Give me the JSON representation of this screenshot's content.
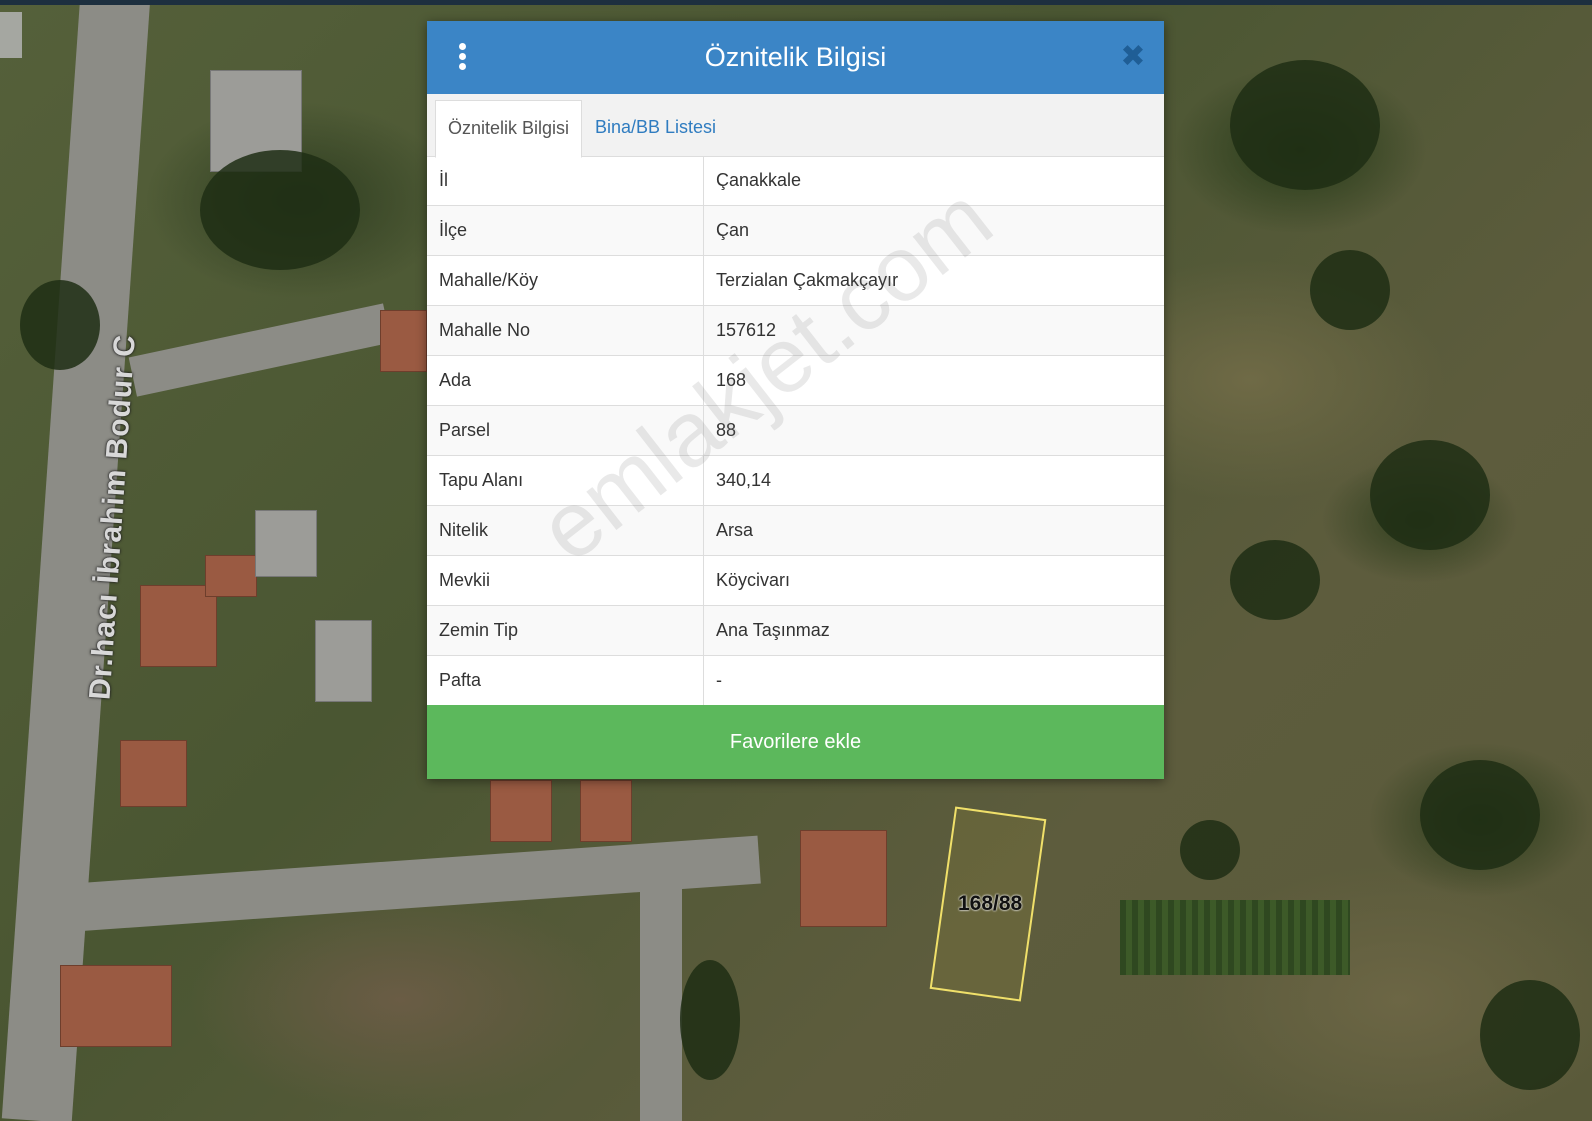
{
  "map": {
    "street_label": "Dr.hacı İbrahim Bodur C",
    "parcel_label": "168/88"
  },
  "dialog": {
    "title": "Öznitelik Bilgisi",
    "tabs": [
      {
        "label": "Öznitelik Bilgisi",
        "active": true
      },
      {
        "label": "Bina/BB Listesi",
        "active": false
      }
    ],
    "rows": [
      {
        "key": "İl",
        "value": "Çanakkale"
      },
      {
        "key": "İlçe",
        "value": "Çan"
      },
      {
        "key": "Mahalle/Köy",
        "value": "Terzialan Çakmakçayır"
      },
      {
        "key": "Mahalle No",
        "value": "157612"
      },
      {
        "key": "Ada",
        "value": "168"
      },
      {
        "key": "Parsel",
        "value": "88"
      },
      {
        "key": "Tapu Alanı",
        "value": "340,14"
      },
      {
        "key": "Nitelik",
        "value": "Arsa"
      },
      {
        "key": "Mevkii",
        "value": "Köycivarı"
      },
      {
        "key": "Zemin Tip",
        "value": "Ana Taşınmaz"
      },
      {
        "key": "Pafta",
        "value": "-"
      }
    ],
    "favorite_button": "Favorilere ekle",
    "icons": {
      "menu": "kebab-menu-icon",
      "close": "close-icon"
    }
  },
  "watermark": "emlakjet.com",
  "colors": {
    "header": "#3b85c6",
    "button": "#5cb85c",
    "tab_link": "#2f7cc0",
    "parcel_outline": "#f0e06a"
  }
}
